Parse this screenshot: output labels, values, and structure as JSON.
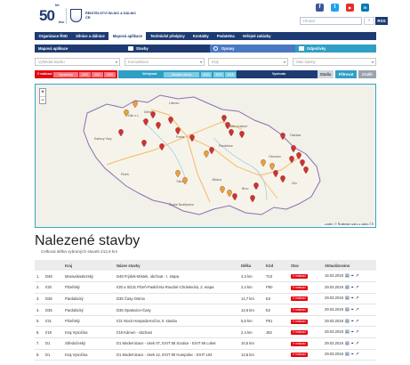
{
  "header": {
    "logo_number": "50",
    "logo_sup": "let",
    "logo_sub": "ŘSD",
    "org_name": "Ředitelství silnic a dálnic ČR",
    "search": {
      "placeholder": "Hledat"
    },
    "search_button": "›",
    "rss_label": "RSS",
    "social": [
      {
        "icon": "facebook-icon",
        "glyph": "f",
        "color": "#3b5998"
      },
      {
        "icon": "twitter-icon",
        "glyph": "t",
        "color": "#1da1f2"
      },
      {
        "icon": "youtube-icon",
        "glyph": "▶",
        "color": "#e52d27"
      },
      {
        "icon": "linkedin-icon",
        "glyph": "in",
        "color": "#0077b5"
      }
    ]
  },
  "nav": [
    {
      "label": "Organizace ŘSD",
      "active": false
    },
    {
      "label": "Silnice a dálnice",
      "active": false
    },
    {
      "label": "Mapová aplikace",
      "active": true
    },
    {
      "label": "Technické předpisy",
      "active": false
    },
    {
      "label": "Kontakty",
      "active": false
    },
    {
      "label": "Podatelna",
      "active": false
    },
    {
      "label": "Veřejné zakázky",
      "active": false
    }
  ],
  "filter": {
    "tab_map": "Mapová aplikace",
    "tab_stavby": "Stavby",
    "tab_opravy": "Opravy",
    "tab_odpocivky": "Odpočívky",
    "select_stavba": "Vyhledat stavbu",
    "select_komunikace": "Komunikace",
    "select_kraj": "Kraj",
    "select_stav": "Stav stavby",
    "status_label": "V realizaci",
    "status_chips": [
      "Dynamický"
    ],
    "years_a": [
      "2022",
      "2021",
      "2020"
    ],
    "publicity_label": "Veřejnost",
    "publicity_chips": [
      "Zahájení stavby"
    ],
    "years_b": [
      "2020",
      "2019",
      "2018"
    ],
    "state_label": "Vyvinuto",
    "state_chip": "Stadia",
    "filter_button": "Filtrovat",
    "reset_button": "Zrušit"
  },
  "map": {
    "zoom_in": "+",
    "zoom_out": "−",
    "attribution": "Leaflet | © Ředitelství silnic a dálnic ČR",
    "place_labels": [
      "Liberec",
      "Děčín",
      "Ústí n.L.",
      "Karlovy Vary",
      "Praha",
      "Hradec Králové",
      "Pardubice",
      "Plzeň",
      "České Budějovice",
      "Jihlava",
      "Brno",
      "Olomouc",
      "Ostrava",
      "Zlín",
      "Tábor"
    ]
  },
  "results": {
    "title": "Nalezené stavby",
    "total": "Celková délka vybraných staveb 212,6 km",
    "columns": [
      "",
      "",
      "Kraj",
      "Název stavby",
      "Délka",
      "Kód",
      "Stav",
      "Aktualizováno"
    ],
    "rows": [
      {
        "num": "1.",
        "road": "D48",
        "region": "Moravskoslezský",
        "name": "D48 Frýdek-Místek, obchvat - I. etapa",
        "length": "4,3 km",
        "code": "T10",
        "status": "V realizaci",
        "updated": "15.03.2019"
      },
      {
        "num": "2.",
        "road": "I/20",
        "region": "Plzeňský",
        "name": "I/20 a II/231 Plzeň-Pasků-Na Roudné-Chrástecká, 2. etapa",
        "length": "2,4 km",
        "code": "P50",
        "status": "V realizaci",
        "updated": "29.03.2019"
      },
      {
        "num": "3.",
        "road": "D35",
        "region": "Pardubický",
        "name": "D35 Časy-Ostrov",
        "length": "14,7 km",
        "code": "E3",
        "status": "V realizaci",
        "updated": "29.03.2019"
      },
      {
        "num": "4.",
        "road": "D35",
        "region": "Pardubický",
        "name": "D35 Opatovice-Časy",
        "length": "12,6 km",
        "code": "E2",
        "status": "V realizaci",
        "updated": "29.03.2019"
      },
      {
        "num": "5.",
        "road": "I/21",
        "region": "Plzeňský",
        "name": "I/21 Nová Hospoda-Kočov, II. stavba",
        "length": "5,6 km",
        "code": "P51",
        "status": "V realizaci",
        "updated": "29.03.2019"
      },
      {
        "num": "6.",
        "road": "I/19",
        "region": "Kraj Vysočina",
        "name": "I/19 Kámen - obchvat",
        "length": "2,4 km",
        "code": "J63",
        "status": "V realizaci",
        "updated": "29.03.2019"
      },
      {
        "num": "7.",
        "road": "D1",
        "region": "Středočeský",
        "name": "D1 Modernizace - úsek 07, EXIT 56 Soutice - EXIT 66 Loket",
        "length": "10,5 km",
        "code": "",
        "status": "V realizaci",
        "updated": "29.03.2019"
      },
      {
        "num": "8.",
        "road": "D1",
        "region": "Kraj Vysočina",
        "name": "D1 Modernizace - úsek 12, EXIT 90 Humpolec - EXIT 104",
        "length": "13,6 km",
        "code": "",
        "status": "V realizaci",
        "updated": "29.03.2019"
      }
    ]
  },
  "colors": {
    "brand": "#1d3b72",
    "accent": "#e30613",
    "map_border": "#34a7c5"
  }
}
